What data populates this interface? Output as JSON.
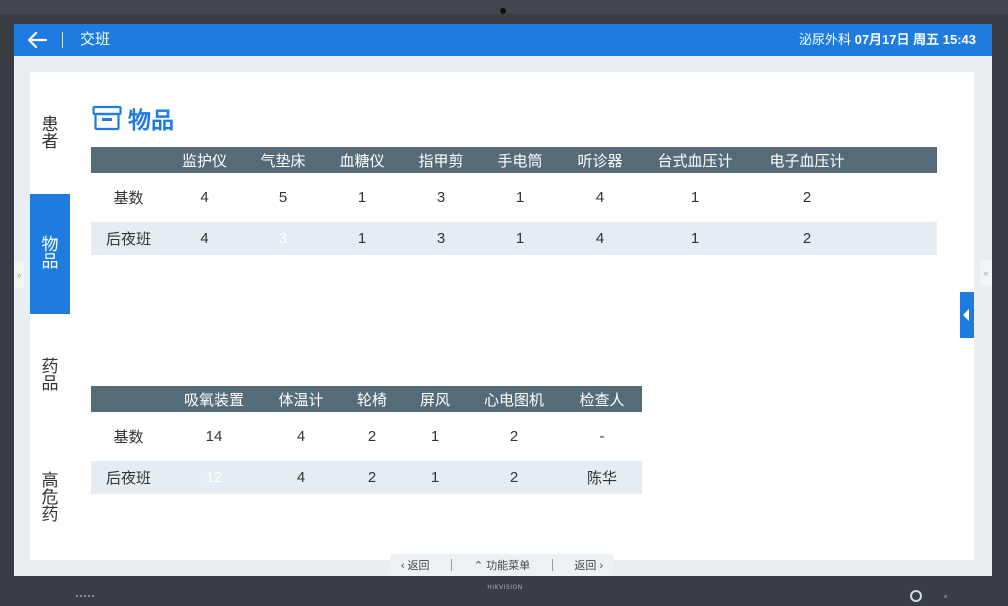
{
  "header": {
    "title": "交班",
    "department": "泌尿外科",
    "datetime": "07月17日 周五 15:43"
  },
  "sidenav": {
    "items": [
      {
        "id": "patients",
        "chars": [
          "患",
          "者"
        ],
        "active": false
      },
      {
        "id": "supplies",
        "chars": [
          "物",
          "品"
        ],
        "active": true
      },
      {
        "id": "drugs",
        "chars": [
          "药",
          "品"
        ],
        "active": false
      },
      {
        "id": "high-risk",
        "chars": [
          "高",
          "危",
          "药"
        ],
        "active": false
      }
    ]
  },
  "section": {
    "title": "物品",
    "icon": "archive-box-icon"
  },
  "table1": {
    "headers": [
      "",
      "监护仪",
      "气垫床",
      "血糖仪",
      "指甲剪",
      "手电筒",
      "听诊器",
      "台式血压计",
      "电子血压计"
    ],
    "rows": [
      [
        "基数",
        "4",
        "5",
        "1",
        "3",
        "1",
        "4",
        "1",
        "2"
      ],
      [
        "后夜班",
        "4",
        "3",
        "1",
        "3",
        "1",
        "4",
        "1",
        "2"
      ]
    ]
  },
  "table2": {
    "headers": [
      "",
      "吸氧装置",
      "体温计",
      "轮椅",
      "屏风",
      "心电图机",
      "检查人"
    ],
    "rows": [
      [
        "基数",
        "14",
        "4",
        "2",
        "1",
        "2",
        "-"
      ],
      [
        "后夜班",
        "12",
        "4",
        "2",
        "1",
        "2",
        "陈华"
      ]
    ]
  },
  "bottombar": {
    "back_label": "返回",
    "menu_label": "功能菜单",
    "return_label": "返回"
  },
  "bezel": {
    "brand": "HIKVISION"
  },
  "colors": {
    "accent": "#1e7be0",
    "header_row": "#556b78",
    "row_shade": "#e6edf2"
  }
}
